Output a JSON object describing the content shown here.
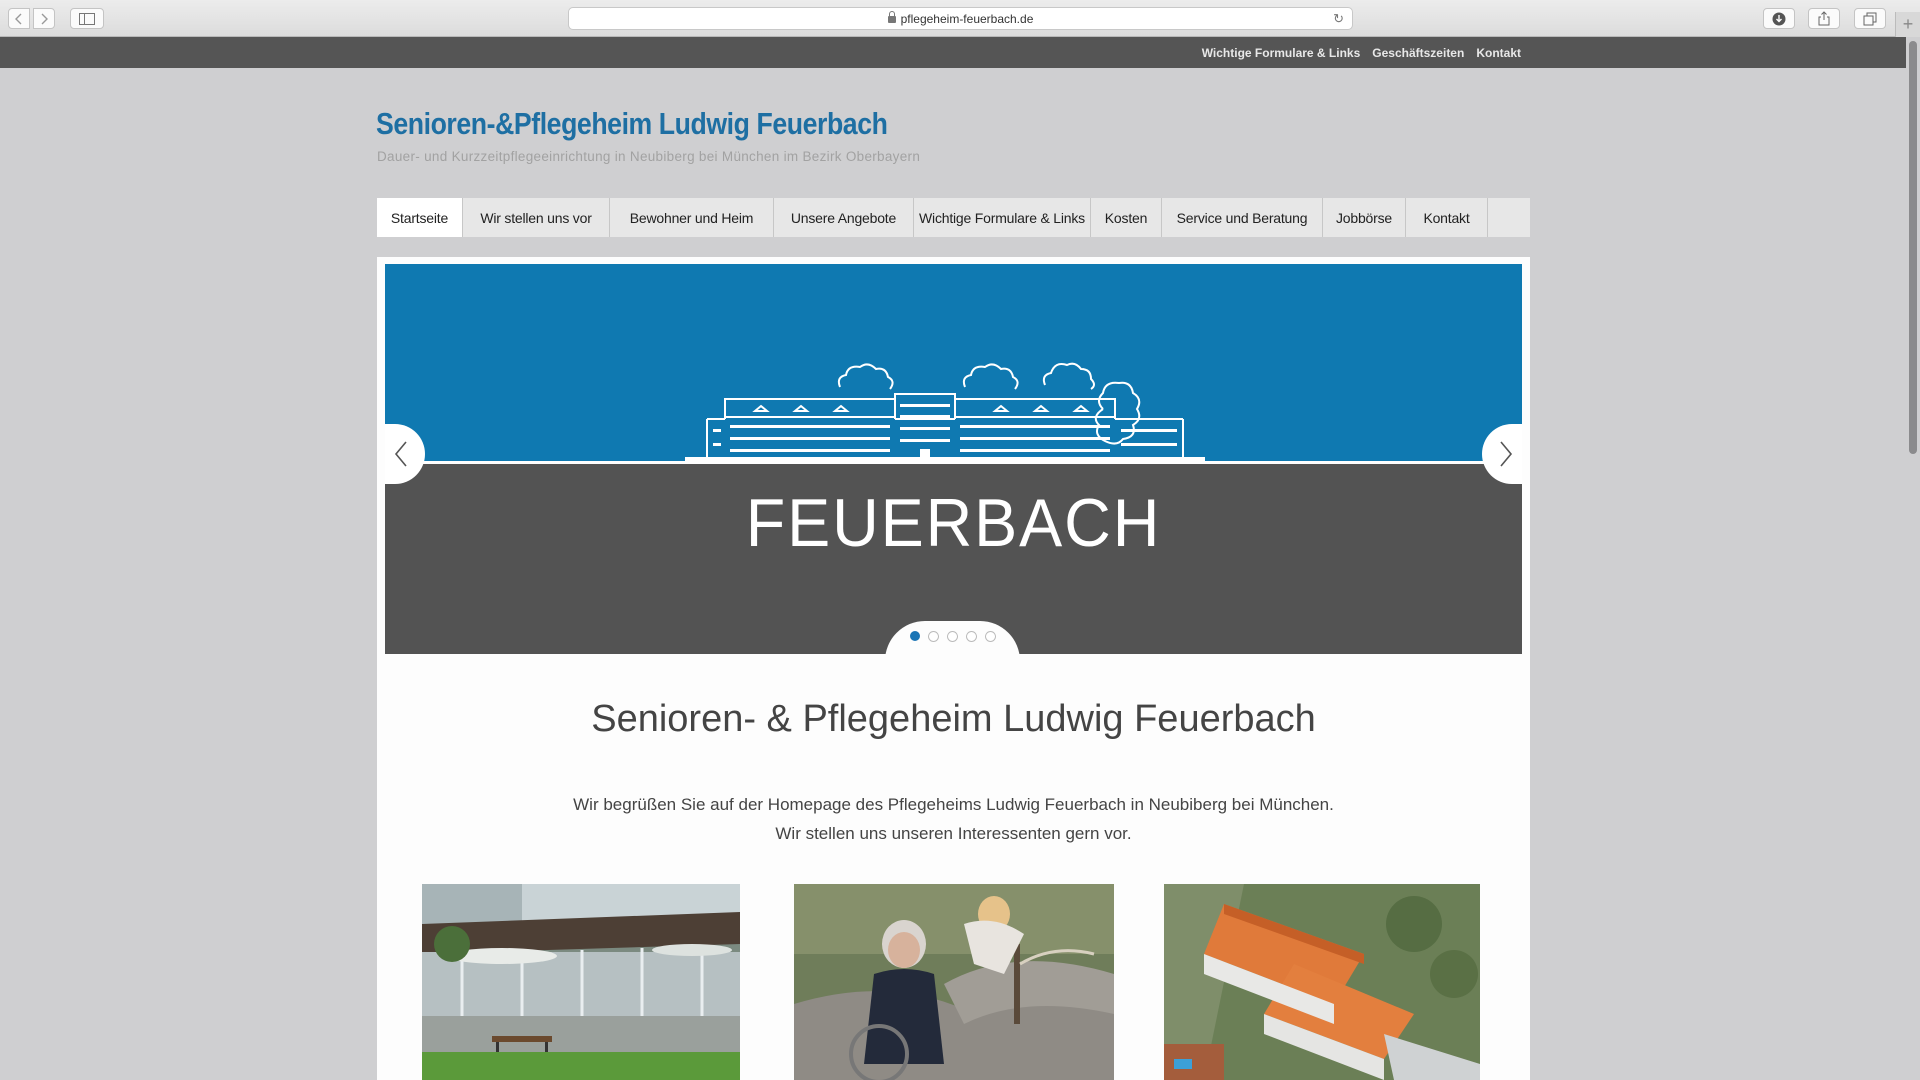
{
  "browser": {
    "url": "pflegeheim-feuerbach.de",
    "back_icon": "chevron-left-icon",
    "forward_icon": "chevron-right-icon",
    "sidebar_icon": "sidebar-icon",
    "download_icon": "download-icon",
    "share_icon": "share-icon",
    "tabs_icon": "tabs-icon",
    "new_tab": "+"
  },
  "topbar": {
    "links": [
      "Wichtige Formulare & Links",
      "Geschäftszeiten",
      "Kontakt"
    ]
  },
  "header": {
    "title": "Senioren-&Pflegeheim Ludwig Feuerbach",
    "subtitle": "Dauer- und Kurzzeitpflegeeinrichtung in Neubiberg bei München im Bezirk Oberbayern"
  },
  "nav": {
    "items": [
      "Startseite",
      "Wir stellen uns vor",
      "Bewohner und Heim",
      "Unsere Angebote",
      "Wichtige Formulare & Links",
      "Kosten",
      "Service und Beratung",
      "Jobbörse",
      "Kontakt"
    ],
    "active": "Startseite"
  },
  "slider": {
    "caption": "FEUERBACH",
    "slide_count": 5,
    "active_slide": 1
  },
  "content": {
    "heading": "Senioren- & Pflegeheim Ludwig Feuerbach",
    "welcome_line1": "Wir begrüßen Sie auf der Homepage des Pflegeheims Ludwig Feuerbach in Neubiberg bei München.",
    "welcome_line2": "Wir stellen uns unseren Interessenten gern vor."
  },
  "colors": {
    "brand_blue": "#1e6fa3",
    "slider_blue": "#0f79b1",
    "slider_grey": "#535353",
    "topbar": "#555555",
    "page_bg": "#cfcfd1"
  }
}
